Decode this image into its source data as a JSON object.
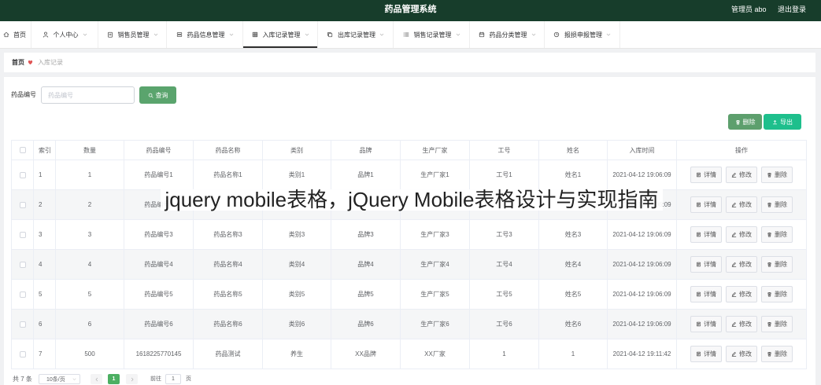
{
  "header": {
    "title": "药品管理系统",
    "user": "管理员 abo",
    "logout": "退出登录"
  },
  "nav": [
    {
      "label": "首页",
      "icon": "home-icon"
    },
    {
      "label": "个人中心",
      "icon": "user-icon",
      "has_dropdown": true
    },
    {
      "label": "销售员管理",
      "icon": "clipboard-icon",
      "has_dropdown": true
    },
    {
      "label": "药品信息管理",
      "icon": "server-icon",
      "has_dropdown": true
    },
    {
      "label": "入库记录管理",
      "icon": "table-icon",
      "has_dropdown": true,
      "active": true
    },
    {
      "label": "出库记录管理",
      "icon": "copy-icon",
      "has_dropdown": true
    },
    {
      "label": "销售记录管理",
      "icon": "list-icon",
      "has_dropdown": true
    },
    {
      "label": "药品分类管理",
      "icon": "calendar-icon",
      "has_dropdown": true
    },
    {
      "label": "报损申报管理",
      "icon": "clock-icon",
      "has_dropdown": true
    }
  ],
  "breadcrumb": {
    "home": "首页",
    "separator_icon": "heart-icon",
    "current": "入库记录"
  },
  "search": {
    "label": "药品编号",
    "placeholder": "药品编号",
    "value": "",
    "button": "查询",
    "button_icon": "search-icon"
  },
  "toolbar": {
    "delete": "删除",
    "delete_icon": "trash-icon",
    "export": "导出",
    "export_icon": "upload-icon"
  },
  "table": {
    "columns": [
      "索引",
      "数量",
      "药品编号",
      "药品名称",
      "类别",
      "品牌",
      "生产厂家",
      "工号",
      "姓名",
      "入库时间",
      "操作"
    ],
    "rows": [
      [
        "1",
        "1",
        "药品编号1",
        "药品名称1",
        "类别1",
        "品牌1",
        "生产厂家1",
        "工号1",
        "姓名1",
        "2021-04-12 19:06:09"
      ],
      [
        "2",
        "2",
        "药品编号2",
        "",
        "",
        "",
        "",
        "",
        "",
        "2021-04-12 19:06:09"
      ],
      [
        "3",
        "3",
        "药品编号3",
        "药品名称3",
        "类别3",
        "品牌3",
        "生产厂家3",
        "工号3",
        "姓名3",
        "2021-04-12 19:06:09"
      ],
      [
        "4",
        "4",
        "药品编号4",
        "药品名称4",
        "类别4",
        "品牌4",
        "生产厂家4",
        "工号4",
        "姓名4",
        "2021-04-12 19:06:09"
      ],
      [
        "5",
        "5",
        "药品编号5",
        "药品名称5",
        "类别5",
        "品牌5",
        "生产厂家5",
        "工号5",
        "姓名5",
        "2021-04-12 19:06:09"
      ],
      [
        "6",
        "6",
        "药品编号6",
        "药品名称6",
        "类别6",
        "品牌6",
        "生产厂家6",
        "工号6",
        "姓名6",
        "2021-04-12 19:06:09"
      ],
      [
        "7",
        "500",
        "1618225770145",
        "药品测试",
        "养生",
        "XX品牌",
        "XX厂家",
        "1",
        "1",
        "2021-04-12 19:11:42"
      ]
    ],
    "row_actions": {
      "detail": "详情",
      "edit": "修改",
      "delete": "删除"
    }
  },
  "pagination": {
    "total": "共 7 条",
    "page_size": "10条/页",
    "current_page": "1",
    "goto_label": "前往",
    "goto_value": "1",
    "page_suffix": "页"
  },
  "overlay": {
    "text": "jquery mobile表格，jQuery Mobile表格设计与实现指南"
  },
  "colors": {
    "header_bg": "#173d2b",
    "primary_green": "#5aa46d",
    "export_green": "#1ebf8c",
    "pagination_active": "#4caf62",
    "heart": "#e05555",
    "row_stripe": "#f5f6f7"
  }
}
